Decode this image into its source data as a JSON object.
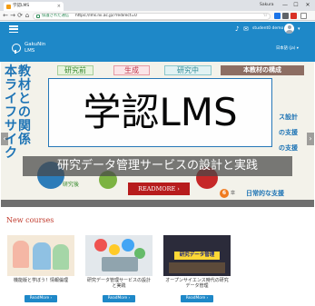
{
  "browser": {
    "tab_title": "学認LMS",
    "tab_close": "×",
    "profile_name": "Sakura",
    "window_controls": [
      "—",
      "☐",
      "✕"
    ],
    "back": "←",
    "forward": "→",
    "reload": "⟳",
    "home": "⌂",
    "secure_label": "保護された通信",
    "url": "https://lms.nii.ac.jp/?redirect=0",
    "bookmark_icon": "star-icon"
  },
  "header": {
    "menu_icon": "hamburger-icon",
    "bell": "♪",
    "chat": "✉",
    "user_name": "student0 demo",
    "user_caret": "▾",
    "brand_line1": "GakuNin",
    "brand_line2": "LMS",
    "language": "日本語 (ja) ▾"
  },
  "slider": {
    "title": "学認LMS",
    "caption": "研究データ管理サービスの設計と実践",
    "readmore": "READMORE ›",
    "prev": "‹",
    "next": "›",
    "bg": {
      "phase_1": "研究前",
      "phase_2": "生成",
      "phase_3": "研究中",
      "vertical_text_1": "本ライフサイク",
      "vertical_text_2": "教材との関係",
      "structure_title": "本教材の構成",
      "item_1": "ス設計",
      "item_2": "の支援",
      "item_3": "の支援",
      "item_6": "日常的な支援",
      "num_6": "6",
      "chapter_6": "章",
      "after": "研究後"
    }
  },
  "courses": {
    "section_title": "New courses",
    "items": [
      {
        "title": "機能版と学ぼう！情報倫理",
        "button": "ReadMore ›"
      },
      {
        "title": "研究データ管理サービスの設計と実践",
        "button": "ReadMore ›"
      },
      {
        "title": "オープンサイエンス時代の研究データ管理",
        "button": "ReadMore ›"
      }
    ],
    "card3_banner": "研究データ管理"
  }
}
